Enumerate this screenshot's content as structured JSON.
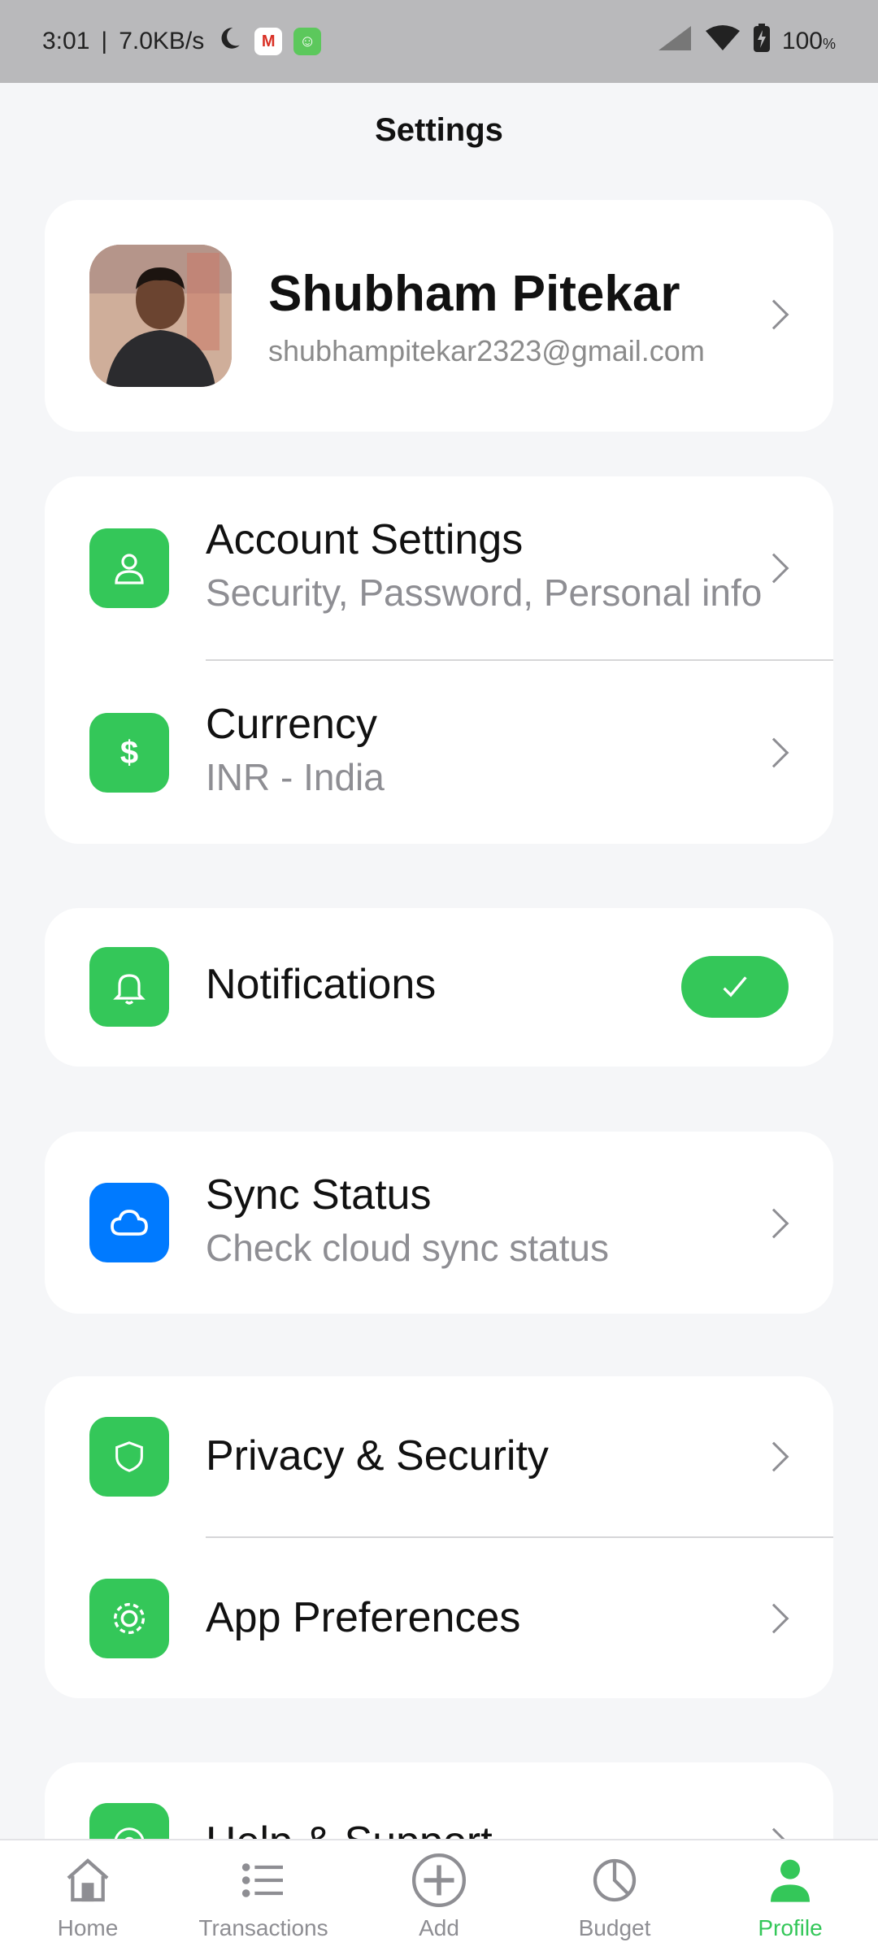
{
  "status_bar": {
    "time": "3:01",
    "speed": "7.0KB/s",
    "battery": "100"
  },
  "page": {
    "title": "Settings"
  },
  "profile": {
    "name": "Shubham Pitekar",
    "email": "shubhampitekar2323@gmail.com"
  },
  "settings": {
    "account": {
      "title": "Account Settings",
      "subtitle": "Security, Password, Personal info"
    },
    "currency": {
      "title": "Currency",
      "subtitle": "INR - India"
    },
    "notifications": {
      "title": "Notifications",
      "enabled": true
    },
    "sync": {
      "title": "Sync Status",
      "subtitle": "Check cloud sync status"
    },
    "privacy": {
      "title": "Privacy & Security"
    },
    "preferences": {
      "title": "App Preferences"
    },
    "help": {
      "title": "Help & Support"
    }
  },
  "nav": {
    "items": [
      {
        "label": "Home",
        "icon": "home-icon"
      },
      {
        "label": "Transactions",
        "icon": "list-icon"
      },
      {
        "label": "Add",
        "icon": "add-icon"
      },
      {
        "label": "Budget",
        "icon": "pie-chart-icon"
      },
      {
        "label": "Profile",
        "icon": "person-icon",
        "active": true
      }
    ]
  },
  "colors": {
    "accent": "#34c759",
    "sync_blue": "#007aff",
    "muted": "#8e8e93",
    "background": "#f5f6f8"
  }
}
